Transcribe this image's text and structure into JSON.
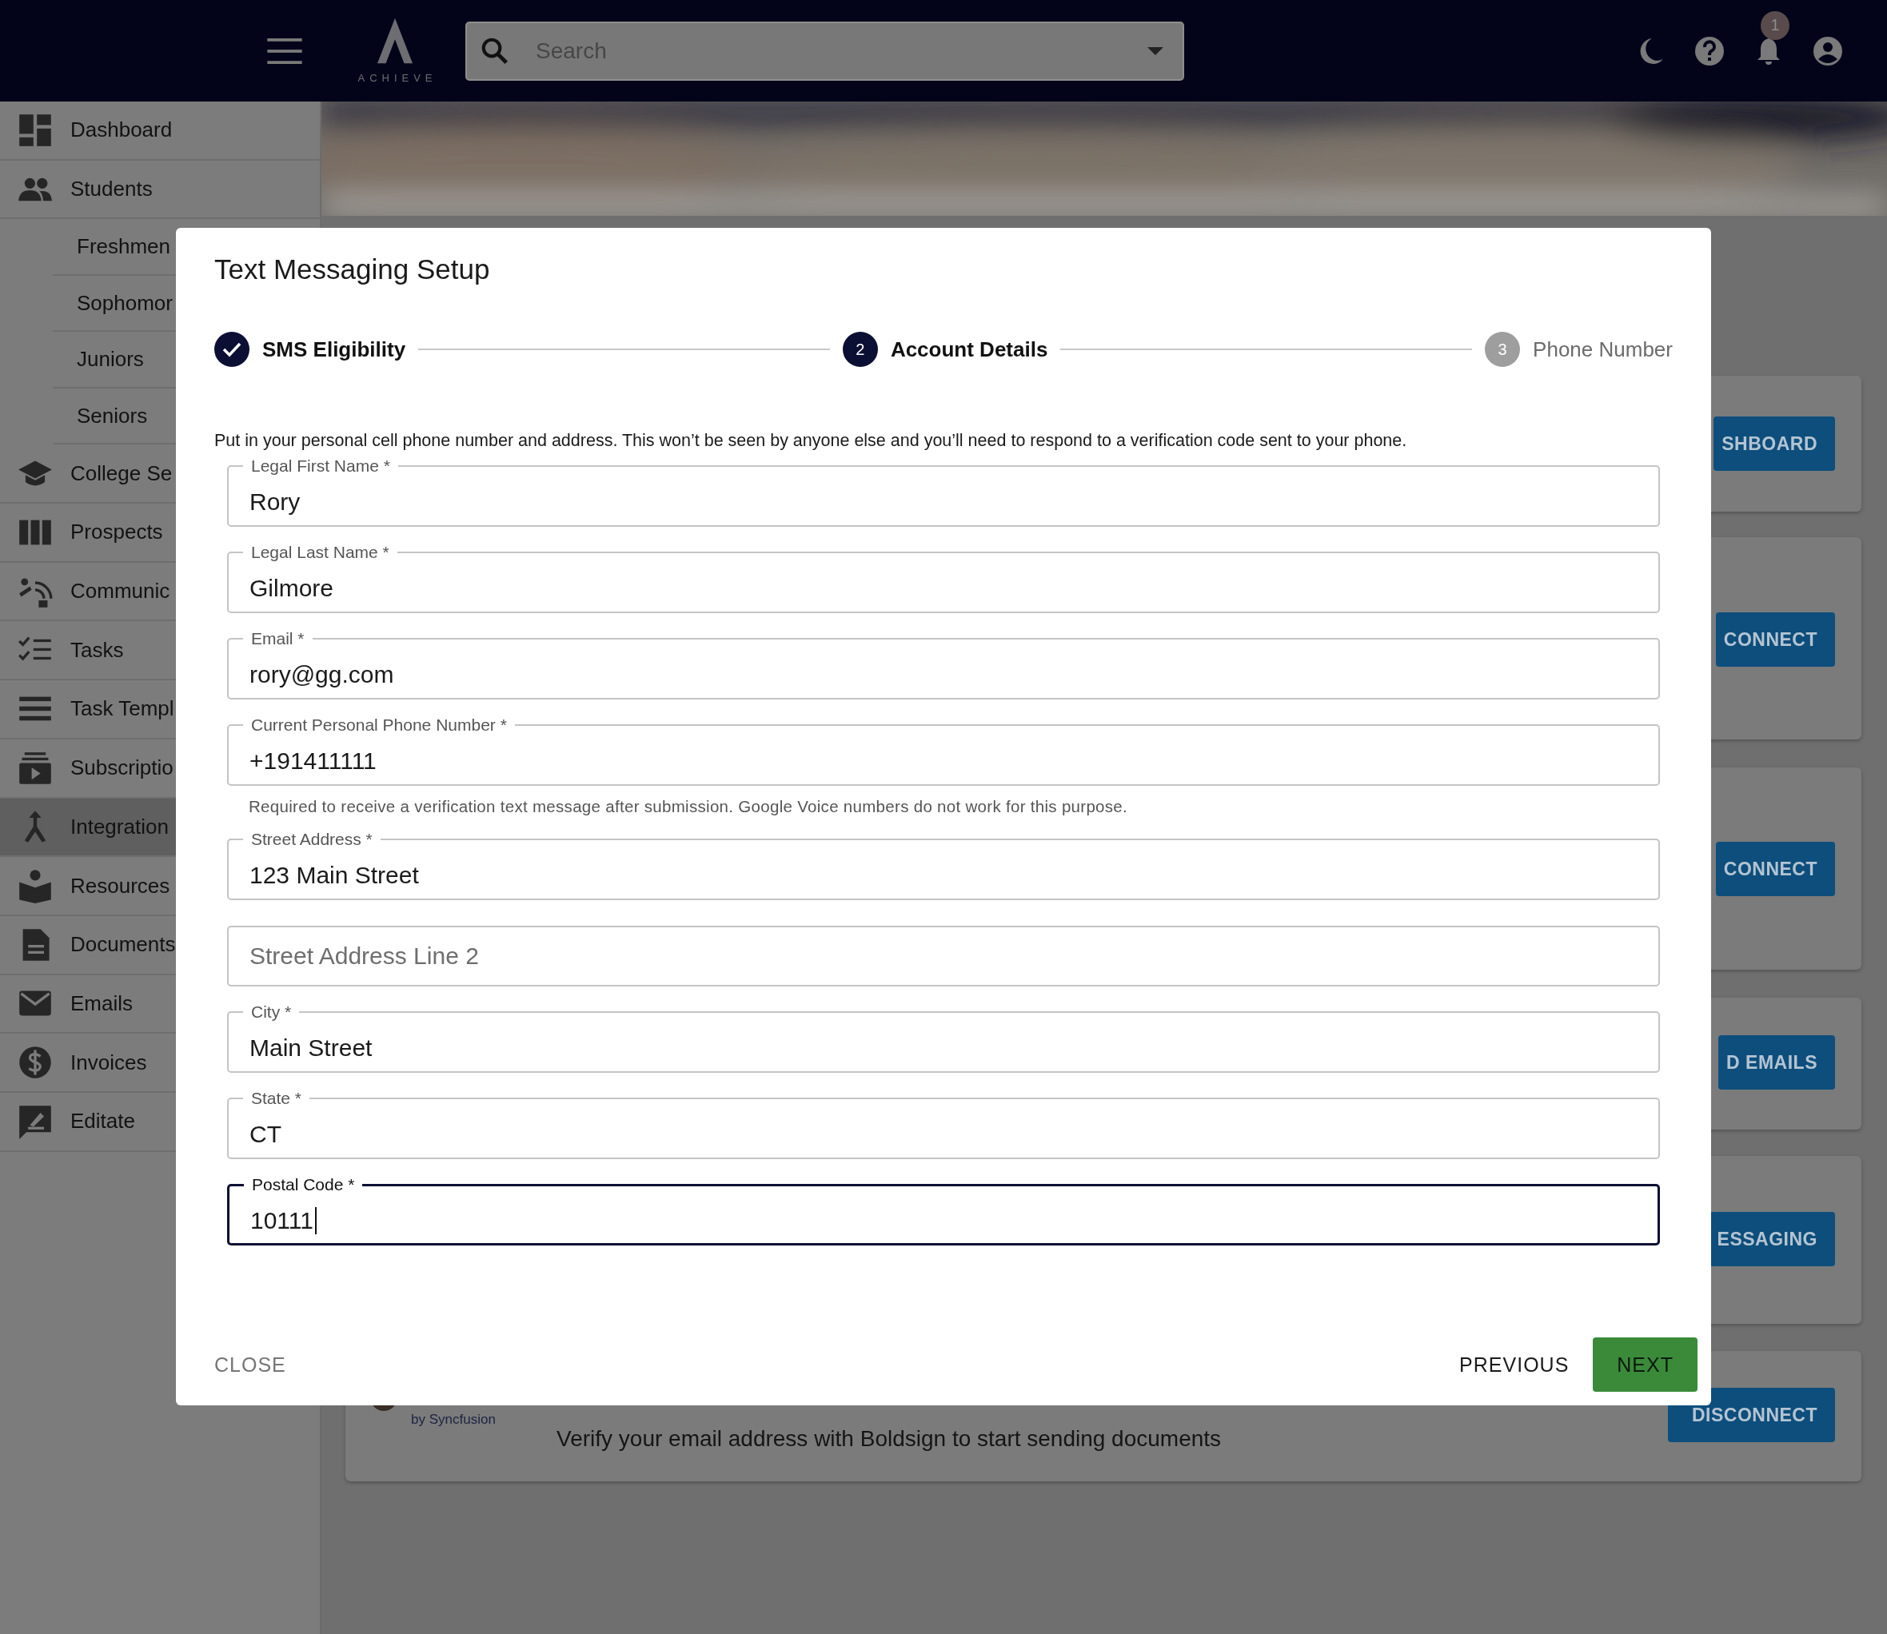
{
  "topbar": {
    "logo_text": "ACHIEVE",
    "search": {
      "placeholder": "Search"
    },
    "notification_count": "1"
  },
  "sidebar": {
    "items": [
      {
        "label": "Dashboard",
        "selected": false
      },
      {
        "label": "Students",
        "selected": false,
        "children": [
          {
            "label": "Freshmen",
            "selected": false
          },
          {
            "label": "Sophomor",
            "selected": false
          },
          {
            "label": "Juniors",
            "selected": false
          },
          {
            "label": "Seniors",
            "selected": false
          }
        ]
      },
      {
        "label": "College Se",
        "selected": false
      },
      {
        "label": "Prospects",
        "selected": false
      },
      {
        "label": "Communic",
        "selected": false
      },
      {
        "label": "Tasks",
        "selected": false
      },
      {
        "label": "Task Templ",
        "selected": false
      },
      {
        "label": "Subscriptio",
        "selected": false
      },
      {
        "label": "Integration",
        "selected": true
      },
      {
        "label": "Resources",
        "selected": false
      },
      {
        "label": "Documents",
        "selected": false
      },
      {
        "label": "Emails",
        "selected": false
      },
      {
        "label": "Invoices",
        "selected": false
      },
      {
        "label": "Editate",
        "selected": false
      }
    ]
  },
  "integrations": [
    {
      "button": "SHBOARD"
    },
    {
      "button": "CONNECT"
    },
    {
      "button": "CONNECT"
    },
    {
      "button": "D EMAILS"
    },
    {
      "button": "ESSAGING"
    },
    {
      "logo_caption": "by Syncfusion",
      "description": "Verify your email address with Boldsign to start sending documents",
      "button": "DISCONNECT"
    }
  ],
  "dialog": {
    "title": "Text Messaging Setup",
    "steps": [
      {
        "label": "SMS Eligibility",
        "completed": true,
        "selected": false
      },
      {
        "number": "2",
        "label": "Account Details",
        "completed": false,
        "selected": true
      },
      {
        "number": "3",
        "label": "Phone Number",
        "completed": false,
        "selected": false
      }
    ],
    "instructions": "Put in your personal cell phone number and address. This won’t be seen by anyone else and you’ll need to respond to a verification code sent to your phone.",
    "fields": [
      {
        "label": "Legal First Name *",
        "value": "Rory",
        "focused": false
      },
      {
        "label": "Legal Last Name *",
        "value": "Gilmore",
        "focused": false
      },
      {
        "label": "Email *",
        "value": "rory@gg.com",
        "focused": false
      },
      {
        "label": "Current Personal Phone Number *",
        "value": "+191411111",
        "focused": false,
        "helper": "Required to receive a verification text message after submission. Google Voice numbers do not work for this purpose."
      },
      {
        "label": "Street Address *",
        "value": "123 Main Street",
        "focused": false
      },
      {
        "placeholder": "Street Address Line 2",
        "focused": false
      },
      {
        "label": "City *",
        "value": "Main Street",
        "focused": false
      },
      {
        "label": "State *",
        "value": "CT",
        "focused": false
      },
      {
        "label": "Postal Code *",
        "value": "10111",
        "focused": true
      }
    ],
    "actions": {
      "close": "CLOSE",
      "previous": "PREVIOUS",
      "next": "NEXT"
    }
  }
}
